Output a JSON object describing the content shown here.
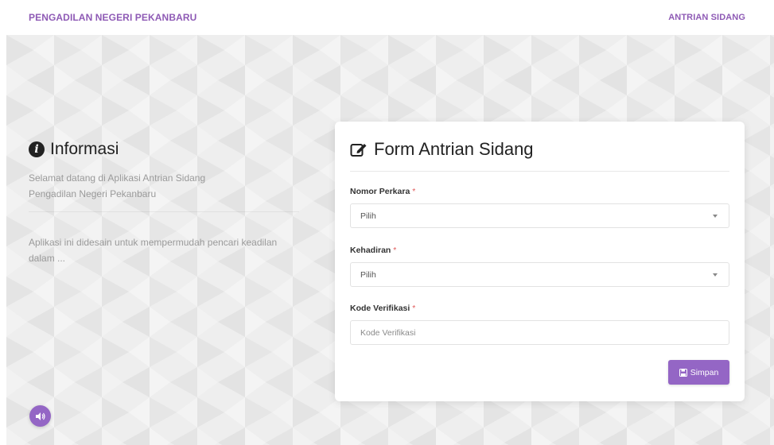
{
  "navbar": {
    "brand": "PENGADILAN NEGERI PEKANBARU",
    "link": "ANTRIAN SIDANG"
  },
  "info": {
    "title": "Informasi",
    "icon": "info-circle-icon",
    "paragraph1_line1": "Selamat datang di Aplikasi Antrian Sidang",
    "paragraph1_line2": "Pengadilan Negeri Pekanbaru",
    "paragraph2_line1": "Aplikasi ini didesain untuk mempermudah pencari keadilan",
    "paragraph2_line2": "dalam ..."
  },
  "form": {
    "title": "Form Antrian Sidang",
    "icon": "edit-icon",
    "nomor_perkara": {
      "label": "Nomor Perkara",
      "required": "*",
      "value": "Pilih"
    },
    "kehadiran": {
      "label": "Kehadiran",
      "required": "*",
      "value": "Pilih"
    },
    "kode_verifikasi": {
      "label": "Kode Verifikasi",
      "required": "*",
      "placeholder": "Kode Verifikasi"
    },
    "submit_label": "Simpan",
    "submit_icon": "save-icon"
  },
  "audio_button": {
    "icon": "speaker-icon"
  },
  "colors": {
    "accent": "#9466c5",
    "brand": "#8e5ab5",
    "background": "#eeeeee",
    "required": "#e05a5a"
  }
}
